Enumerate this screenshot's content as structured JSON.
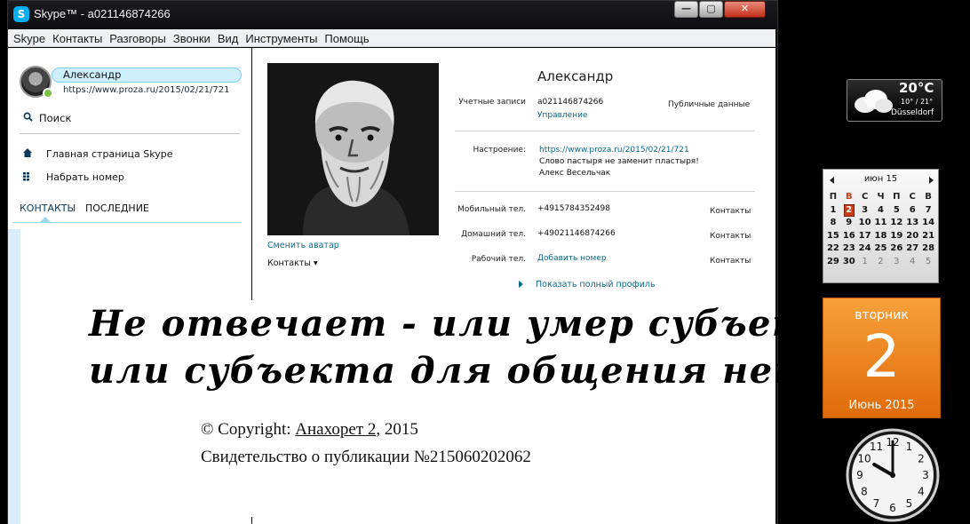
{
  "window": {
    "title": "Skype™ - a021146874266",
    "logo_letter": "S",
    "controls": {
      "minimize": "—",
      "maximize": "▢",
      "close": "✕"
    }
  },
  "menu": [
    "Skype",
    "Контакты",
    "Разговоры",
    "Звонки",
    "Вид",
    "Инструменты",
    "Помощь"
  ],
  "sidebar": {
    "profile_name": "Александр",
    "profile_mood": "https://www.proza.ru/2015/02/21/721",
    "search_label": "Поиск",
    "items": [
      {
        "label": "Главная страница Skype",
        "icon": "home-icon"
      },
      {
        "label": "Набрать номер",
        "icon": "dialpad-icon"
      }
    ],
    "tabs": [
      "КОНТАКТЫ",
      "ПОСЛЕДНИЕ"
    ]
  },
  "profile": {
    "name": "Александр",
    "accounts_label": "Учетные записи",
    "account_id": "a021146874266",
    "manage_link": "Управление",
    "public_data": "Публичные данные",
    "mood_label": "Настроение:",
    "mood_link": "https://www.proza.ru/2015/02/21/721",
    "mood_text_1": "Слово пастыря не заменит пластыря!",
    "mood_text_2": "Алекс Весельчак",
    "change_avatar": "Сменить аватар",
    "contacts_dropdown": "Контакты ▾",
    "phones": [
      {
        "label": "Мобильный тел.",
        "value": "+4915784352498",
        "right": "Контакты"
      },
      {
        "label": "Домашний тел.",
        "value": "+49021146874266",
        "right": "Контакты"
      },
      {
        "label": "Рабочий тел.",
        "value": "Добавить номер",
        "right": "Контакты"
      }
    ],
    "full_profile": "Показать полный профиль"
  },
  "overlay": {
    "line1": "Не отвечает - или умер субъект,",
    "line2": "или субъекта для общения нет!",
    "copyright_prefix": "© Copyright: ",
    "author": "Анахорет 2",
    "year": ", 2015",
    "certificate": "Свидетельство о публикации №215060202062"
  },
  "weather": {
    "temp": "20°C",
    "range": "10° / 21°",
    "city": "Düsseldorf"
  },
  "calendar": {
    "month": "июн 15",
    "weekdays": [
      "П",
      "В",
      "С",
      "Ч",
      "П",
      "С",
      "В"
    ],
    "selected": "2",
    "days": [
      [
        "1",
        "2",
        "3",
        "4",
        "5",
        "6",
        "7"
      ],
      [
        "8",
        "9",
        "10",
        "11",
        "12",
        "13",
        "14"
      ],
      [
        "15",
        "16",
        "17",
        "18",
        "19",
        "20",
        "21"
      ],
      [
        "22",
        "23",
        "24",
        "25",
        "26",
        "27",
        "28"
      ],
      [
        "29",
        "30",
        "1",
        "2",
        "3",
        "4",
        "5"
      ]
    ]
  },
  "date_gadget": {
    "weekday": "вторник",
    "day": "2",
    "month_year": "Июнь 2015"
  },
  "clock": {
    "time": "10:00"
  },
  "colors": {
    "skype_blue": "#00aff0",
    "link": "#0a6a8a",
    "date_orange": "#f08a20",
    "selected_day": "#c73b16"
  }
}
